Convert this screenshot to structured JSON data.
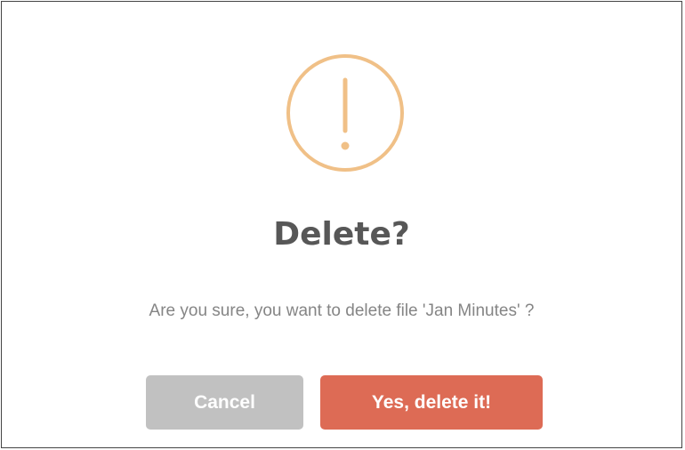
{
  "dialog": {
    "icon": "exclamation-circle-icon",
    "title": "Delete?",
    "message": "Are you sure, you want to delete file 'Jan Minutes' ?",
    "cancel_label": "Cancel",
    "confirm_label": "Yes, delete it!"
  },
  "colors": {
    "icon": "#f0c087",
    "title": "#575757",
    "message": "#858585",
    "cancel_button": "#c1c1c1",
    "confirm_button": "#dd6b55"
  }
}
